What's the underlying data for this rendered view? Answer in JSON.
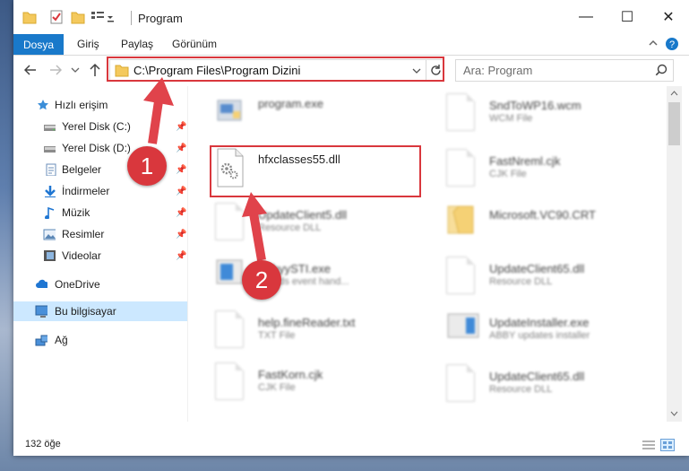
{
  "window": {
    "title": "Program"
  },
  "controls": {
    "minimize": "—",
    "maximize": "☐",
    "close": "✕"
  },
  "ribbon": {
    "tabs": [
      "Dosya",
      "Giriş",
      "Paylaş",
      "Görünüm"
    ]
  },
  "address": {
    "path": "C:\\Program Files\\Program Dizini"
  },
  "search": {
    "placeholder": "Ara: Program"
  },
  "sidebar": {
    "quick_access": "Hızlı erişim",
    "items": [
      {
        "label": "Yerel Disk (C:)",
        "pinned": true
      },
      {
        "label": "Yerel Disk (D:)",
        "pinned": true
      },
      {
        "label": "Belgeler",
        "pinned": true
      },
      {
        "label": "İndirmeler",
        "pinned": true
      },
      {
        "label": "Müzik",
        "pinned": true
      },
      {
        "label": "Resimler",
        "pinned": true
      },
      {
        "label": "Videolar",
        "pinned": true
      }
    ],
    "onedrive": "OneDrive",
    "this_pc": "Bu bilgisayar",
    "network": "Ağ"
  },
  "files": {
    "col1": [
      {
        "name": "program.exe",
        "type": ""
      },
      {
        "name": "hfxclasses55.dll",
        "type": ""
      },
      {
        "name": "UpdateClient5.dll",
        "type": "Resource DLL"
      },
      {
        "name": "AbbyySTI.exe",
        "type": "STI .ds event hand..."
      },
      {
        "name": "help.fineReader.txt",
        "type": "TXT File"
      },
      {
        "name": "FastKorn.cjk",
        "type": "CJK File"
      }
    ],
    "col2": [
      {
        "name": "SndToWP16.wcm",
        "type": "WCM File"
      },
      {
        "name": "FastNreml.cjk",
        "type": "CJK File"
      },
      {
        "name": "Microsoft.VC90.CRT",
        "type": ""
      },
      {
        "name": "UpdateClient65.dll",
        "type": "Resource DLL"
      },
      {
        "name": "UpdateInstaller.exe",
        "type": "ABBY updates installer"
      },
      {
        "name": "UpdateClient65.dll",
        "type": "Resource DLL"
      }
    ]
  },
  "status": {
    "count": "132 öğe"
  },
  "callouts": {
    "one": "1",
    "two": "2"
  },
  "colors": {
    "accent": "#1979ca",
    "highlight": "#d9373d",
    "selected": "#cce8ff"
  }
}
